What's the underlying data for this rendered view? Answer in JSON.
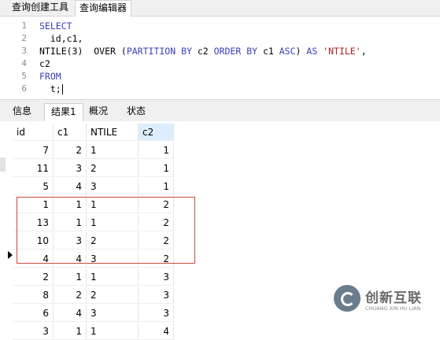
{
  "top_tabs": [
    "查询创建工具",
    "查询编辑器"
  ],
  "editor": {
    "line_numbers": [
      "1",
      "2",
      "3",
      "4",
      "5",
      "6"
    ],
    "lines": [
      {
        "parts": [
          {
            "t": "SELECT",
            "c": "kw"
          }
        ]
      },
      {
        "parts": [
          {
            "t": "  id,c1,",
            "c": ""
          }
        ]
      },
      {
        "parts": [
          {
            "t": "NTILE(3)  ",
            "c": ""
          },
          {
            "t": "OVER",
            "c": ""
          },
          {
            "t": " (",
            "c": ""
          },
          {
            "t": "PARTITION",
            "c": "kw"
          },
          {
            "t": " ",
            "c": ""
          },
          {
            "t": "BY",
            "c": "kw"
          },
          {
            "t": " c2 ",
            "c": ""
          },
          {
            "t": "ORDER",
            "c": "kw"
          },
          {
            "t": " ",
            "c": ""
          },
          {
            "t": "BY",
            "c": "kw"
          },
          {
            "t": " c1 ",
            "c": ""
          },
          {
            "t": "ASC",
            "c": "kw"
          },
          {
            "t": ") ",
            "c": ""
          },
          {
            "t": "AS",
            "c": "kw"
          },
          {
            "t": " ",
            "c": ""
          },
          {
            "t": "'NTILE'",
            "c": "str"
          },
          {
            "t": ",",
            "c": ""
          }
        ]
      },
      {
        "parts": [
          {
            "t": "c2",
            "c": ""
          }
        ]
      },
      {
        "parts": [
          {
            "t": "FROM",
            "c": "kw"
          }
        ]
      },
      {
        "parts": [
          {
            "t": "  t;",
            "c": ""
          }
        ]
      }
    ]
  },
  "result_tabs": [
    "信息",
    "结果1",
    "概况",
    "状态"
  ],
  "active_result_tab": "结果1",
  "table": {
    "columns": [
      "id",
      "c1",
      "NTILE",
      "c2"
    ],
    "rows": [
      [
        "7",
        "2",
        "1",
        "1"
      ],
      [
        "11",
        "3",
        "2",
        "1"
      ],
      [
        "5",
        "4",
        "3",
        "1"
      ],
      [
        "1",
        "1",
        "1",
        "2"
      ],
      [
        "13",
        "1",
        "1",
        "2"
      ],
      [
        "10",
        "3",
        "2",
        "2"
      ],
      [
        "4",
        "4",
        "3",
        "2"
      ],
      [
        "2",
        "1",
        "1",
        "3"
      ],
      [
        "8",
        "2",
        "2",
        "3"
      ],
      [
        "6",
        "4",
        "3",
        "3"
      ],
      [
        "3",
        "1",
        "1",
        "4"
      ]
    ],
    "current_row_index": 6,
    "highlighted_rows": [
      3,
      4,
      5,
      6
    ]
  },
  "colors": {
    "keyword": "#3b40b8",
    "string": "#b02020",
    "highlight_box": "#c84a3c",
    "sorted_header": "#dceefe"
  },
  "watermark": {
    "text": "创新互联",
    "sub": "CHUANG XIN HU LIAN",
    "icon": "logo-icon"
  }
}
